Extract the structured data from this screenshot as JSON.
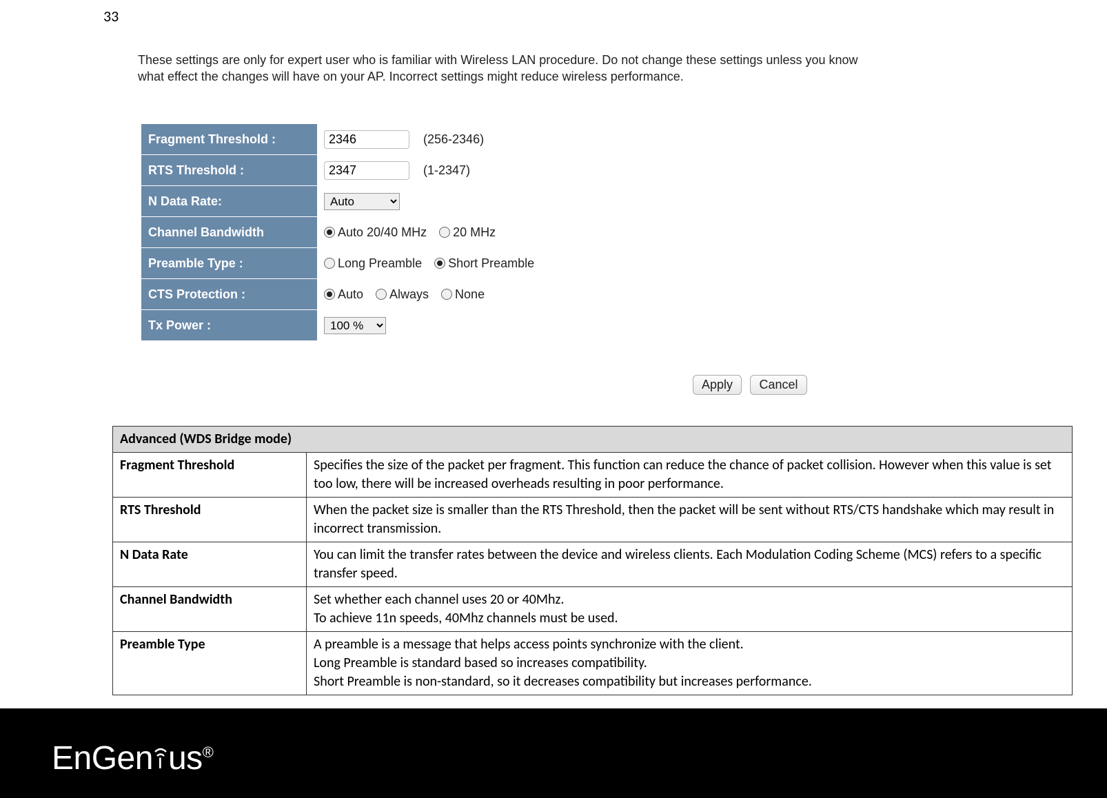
{
  "page_number": "33",
  "intro": "These settings are only for expert user who is familiar with Wireless LAN procedure. Do not change these settings unless you know what effect the changes will have on your AP. Incorrect settings might reduce wireless performance.",
  "settings": {
    "fragment_threshold": {
      "label": "Fragment Threshold :",
      "value": "2346",
      "range": "(256-2346)"
    },
    "rts_threshold": {
      "label": "RTS Threshold :",
      "value": "2347",
      "range": "(1-2347)"
    },
    "n_data_rate": {
      "label": "N Data Rate:",
      "selected": "Auto"
    },
    "channel_bandwidth": {
      "label": "Channel Bandwidth",
      "opt1": "Auto 20/40 MHz",
      "opt2": "20 MHz"
    },
    "preamble_type": {
      "label": "Preamble Type :",
      "opt1": "Long Preamble",
      "opt2": "Short Preamble"
    },
    "cts_protection": {
      "label": "CTS Protection :",
      "opt1": "Auto",
      "opt2": "Always",
      "opt3": "None"
    },
    "tx_power": {
      "label": "Tx Power :",
      "selected": "100 %"
    }
  },
  "buttons": {
    "apply": "Apply",
    "cancel": "Cancel"
  },
  "doc_table": {
    "header": "Advanced (WDS Bridge mode)",
    "rows": [
      {
        "label": "Fragment Threshold",
        "desc": "Specifies the size of the packet per fragment. This function can reduce the chance of packet collision. However when this value is set too low, there will be increased overheads resulting in poor performance."
      },
      {
        "label": "RTS Threshold",
        "desc": "When the packet size is smaller than the RTS Threshold, then the packet will be sent without RTS/CTS handshake which may result in incorrect transmission."
      },
      {
        "label": "N Data Rate",
        "desc": "You can limit the transfer rates between the device and wireless clients. Each Modulation Coding Scheme (MCS) refers to a specific transfer speed."
      },
      {
        "label": "Channel Bandwidth",
        "desc": "Set whether each channel uses 20 or 40Mhz.\nTo achieve 11n speeds, 40Mhz channels must be used."
      },
      {
        "label": "Preamble Type",
        "desc": "A preamble is a message that helps access points synchronize with the client.\nLong Preamble is standard based so increases compatibility.\nShort Preamble is non-standard, so it decreases compatibility but increases performance."
      }
    ]
  },
  "logo": {
    "text_prefix": "EnGen",
    "text_suffix": "us",
    "reg": "®"
  }
}
